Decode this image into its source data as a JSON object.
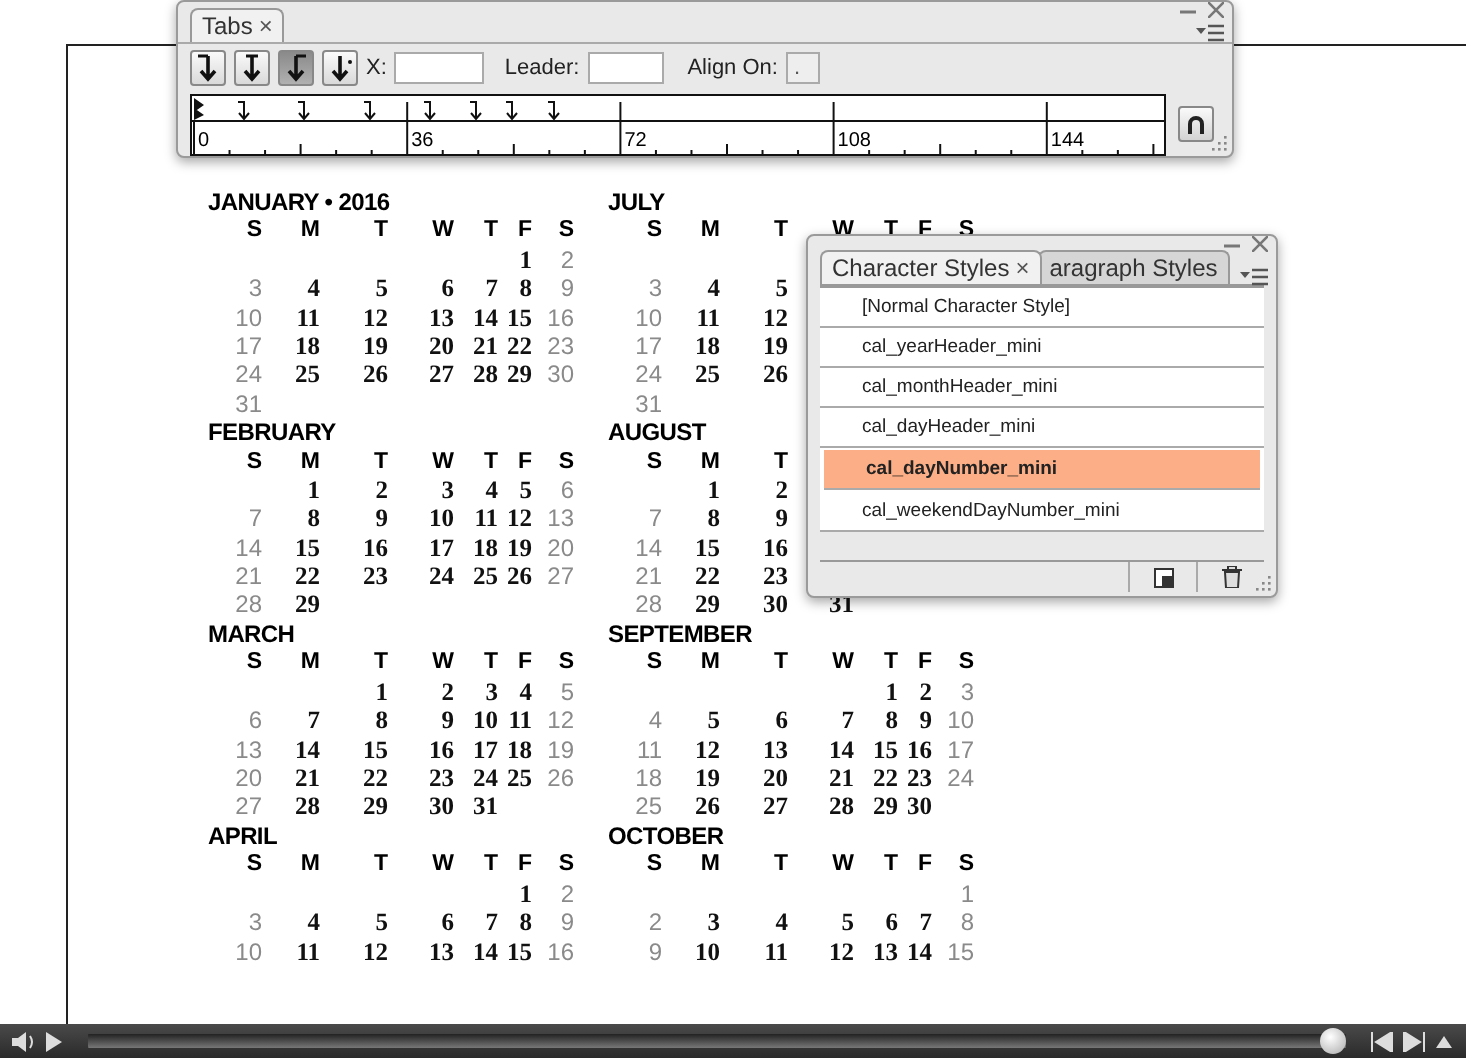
{
  "tabs_panel": {
    "title": "Tabs",
    "close": "×",
    "align_buttons": [
      {
        "kind": "left",
        "selected": false
      },
      {
        "kind": "center",
        "selected": false
      },
      {
        "kind": "right",
        "selected": true
      },
      {
        "kind": "decimal",
        "selected": false
      }
    ],
    "x_label": "X:",
    "leader_label": "Leader:",
    "align_on": {
      "label": "Align On:",
      "value": "."
    },
    "ruler_labels": [
      "0",
      "36",
      "72",
      "108",
      "144"
    ]
  },
  "calendar": {
    "columns": [
      [
        {
          "title": "JANUARY • 2016",
          "weekdays": [
            "S",
            "M",
            "T",
            "W",
            "T",
            "F",
            "S"
          ],
          "weeks": [
            {
              "fr": "1",
              "sa": "2"
            },
            {
              "su": "3",
              "mo": "4",
              "tu": "5",
              "we": "6",
              "th": "7",
              "fr": "8",
              "sa": "9"
            },
            {
              "su": "10",
              "mo": "11",
              "tu": "12",
              "we": "13",
              "th": "14",
              "fr": "15",
              "sa": "16"
            },
            {
              "su": "17",
              "mo": "18",
              "tu": "19",
              "we": "20",
              "th": "21",
              "fr": "22",
              "sa": "23"
            },
            {
              "su": "24",
              "mo": "25",
              "tu": "26",
              "we": "27",
              "th": "28",
              "fr": "29",
              "sa": "30"
            },
            {
              "su": "31"
            }
          ]
        },
        {
          "title": "FEBRUARY",
          "weekdays": [
            "S",
            "M",
            "T",
            "W",
            "T",
            "F",
            "S"
          ],
          "weeks": [
            {
              "mo": "1",
              "tu": "2",
              "we": "3",
              "th": "4",
              "fr": "5",
              "sa": "6"
            },
            {
              "su": "7",
              "mo": "8",
              "tu": "9",
              "we": "10",
              "th": "11",
              "fr": "12",
              "sa": "13"
            },
            {
              "su": "14",
              "mo": "15",
              "tu": "16",
              "we": "17",
              "th": "18",
              "fr": "19",
              "sa": "20"
            },
            {
              "su": "21",
              "mo": "22",
              "tu": "23",
              "we": "24",
              "th": "25",
              "fr": "26",
              "sa": "27"
            },
            {
              "su": "28",
              "mo": "29"
            }
          ]
        },
        {
          "title": "MARCH",
          "weekdays": [
            "S",
            "M",
            "T",
            "W",
            "T",
            "F",
            "S"
          ],
          "weeks": [
            {
              "tu": "1",
              "we": "2",
              "th": "3",
              "fr": "4",
              "sa": "5"
            },
            {
              "su": "6",
              "mo": "7",
              "tu": "8",
              "we": "9",
              "th": "10",
              "fr": "11",
              "sa": "12"
            },
            {
              "su": "13",
              "mo": "14",
              "tu": "15",
              "we": "16",
              "th": "17",
              "fr": "18",
              "sa": "19"
            },
            {
              "su": "20",
              "mo": "21",
              "tu": "22",
              "we": "23",
              "th": "24",
              "fr": "25",
              "sa": "26"
            },
            {
              "su": "27",
              "mo": "28",
              "tu": "29",
              "we": "30",
              "th": "31"
            }
          ]
        },
        {
          "title": "APRIL",
          "weekdays": [
            "S",
            "M",
            "T",
            "W",
            "T",
            "F",
            "S"
          ],
          "weeks": [
            {
              "fr": "1",
              "sa": "2"
            },
            {
              "su": "3",
              "mo": "4",
              "tu": "5",
              "we": "6",
              "th": "7",
              "fr": "8",
              "sa": "9"
            },
            {
              "su": "10",
              "mo": "11",
              "tu": "12",
              "we": "13",
              "th": "14",
              "fr": "15",
              "sa": "16"
            }
          ]
        }
      ],
      [
        {
          "title": "JULY",
          "weekdays": [
            "S",
            "M",
            "T",
            "W",
            "T",
            "F",
            "S"
          ],
          "first_week_hidden": true,
          "weeks": [
            {
              "su": "3",
              "mo": "4",
              "tu": "5"
            },
            {
              "su": "10",
              "mo": "11",
              "tu": "12"
            },
            {
              "su": "17",
              "mo": "18",
              "tu": "19"
            },
            {
              "su": "24",
              "mo": "25",
              "tu": "26"
            },
            {
              "su": "31"
            }
          ]
        },
        {
          "title": "AUGUST",
          "weekdays": [
            "S",
            "M",
            "T"
          ],
          "weeks": [
            {
              "mo": "1",
              "tu": "2"
            },
            {
              "su": "7",
              "mo": "8",
              "tu": "9"
            },
            {
              "su": "14",
              "mo": "15",
              "tu": "16"
            },
            {
              "su": "21",
              "mo": "22",
              "tu": "23"
            },
            {
              "su": "28",
              "mo": "29",
              "tu": "30",
              "we": "31"
            }
          ]
        },
        {
          "title": "SEPTEMBER",
          "weekdays": [
            "S",
            "M",
            "T",
            "W",
            "T",
            "F",
            "S"
          ],
          "weeks": [
            {
              "th": "1",
              "fr": "2",
              "sa": "3"
            },
            {
              "su": "4",
              "mo": "5",
              "tu": "6",
              "we": "7",
              "th": "8",
              "fr": "9",
              "sa": "10"
            },
            {
              "su": "11",
              "mo": "12",
              "tu": "13",
              "we": "14",
              "th": "15",
              "fr": "16",
              "sa": "17"
            },
            {
              "su": "18",
              "mo": "19",
              "tu": "20",
              "we": "21",
              "th": "22",
              "fr": "23",
              "sa": "24"
            },
            {
              "su": "25",
              "mo": "26",
              "tu": "27",
              "we": "28",
              "th": "29",
              "fr": "30"
            }
          ]
        },
        {
          "title": "OCTOBER",
          "weekdays": [
            "S",
            "M",
            "T",
            "W",
            "T",
            "F",
            "S"
          ],
          "weeks": [
            {
              "sa": "1"
            },
            {
              "su": "2",
              "mo": "3",
              "tu": "4",
              "we": "5",
              "th": "6",
              "fr": "7",
              "sa": "8"
            },
            {
              "su": "9",
              "mo": "10",
              "tu": "11",
              "we": "12",
              "th": "13",
              "fr": "14",
              "sa": "15"
            }
          ]
        }
      ]
    ]
  },
  "styles_panel": {
    "tabs": [
      {
        "label": "Character Styles",
        "close": "×",
        "selected": true
      },
      {
        "label": "aragraph Styles",
        "selected": false
      }
    ],
    "items": [
      {
        "label": "[Normal Character Style]",
        "selected": false
      },
      {
        "label": "cal_yearHeader_mini",
        "selected": false
      },
      {
        "label": "cal_monthHeader_mini",
        "selected": false
      },
      {
        "label": "cal_dayHeader_mini",
        "selected": false
      },
      {
        "label": "cal_dayNumber_mini",
        "selected": true
      },
      {
        "label": "cal_weekendDayNumber_mini",
        "selected": false
      }
    ]
  },
  "player": {
    "level": 1
  }
}
